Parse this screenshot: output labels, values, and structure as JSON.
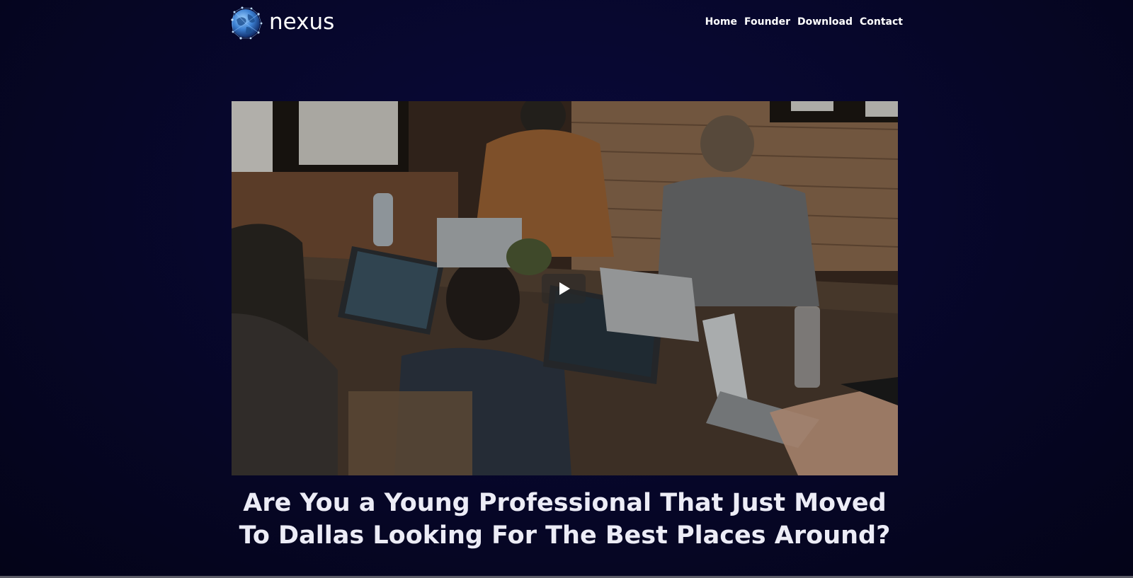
{
  "brand": {
    "name": "nexus",
    "logo_icon": "globe-icon"
  },
  "nav": {
    "items": [
      {
        "label": "Home"
      },
      {
        "label": "Founder"
      },
      {
        "label": "Download"
      },
      {
        "label": "Contact"
      }
    ]
  },
  "hero": {
    "image_subject": "",
    "play_icon": "play-icon"
  },
  "headline": {
    "text": "Are You a Young Professional That Just Moved To Dallas Looking For The Best Places Around?"
  },
  "colors": {
    "background": "#07072c",
    "text": "#ffffff",
    "headline": "#ececf6"
  }
}
